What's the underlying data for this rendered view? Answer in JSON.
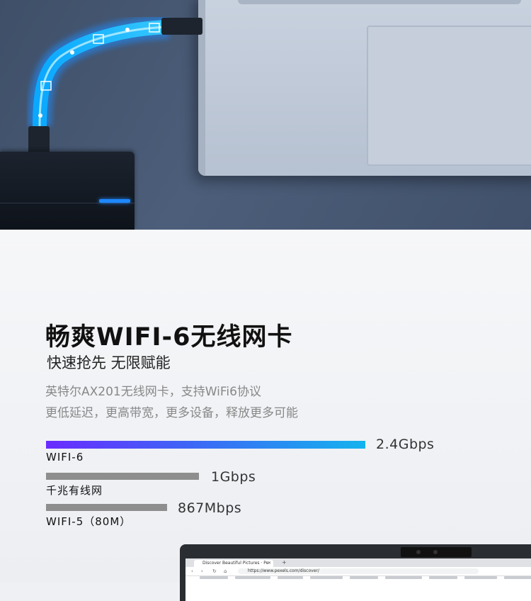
{
  "product": {
    "title": "畅爽WIFI-6无线网卡",
    "subtitle": "快速抢先 无限赋能",
    "description": [
      "英特尔AX201无线网卡，支持WiFi6协议",
      "更低延迟，更高带宽，更多设备，释放更多可能"
    ]
  },
  "speed_comparison": [
    {
      "name": "WIFI-6",
      "speed": "2.4Gbps",
      "value_mbps": 2400,
      "color": "#3d66f6"
    },
    {
      "name": "千兆有线网",
      "speed": "1Gbps",
      "value_mbps": 1000,
      "color": "#8e8e8e"
    },
    {
      "name": "WIFI-5（80M）",
      "speed": "867Mbps",
      "value_mbps": 867,
      "color": "#8e8e8e"
    }
  ],
  "browser": {
    "tab_title": "Discover Beautiful Pictures · Pe",
    "url": "https://www.pexels.com/discover/"
  },
  "icons": {
    "ssd_plug": "ssd-icon",
    "camera": "webcam-icon"
  }
}
